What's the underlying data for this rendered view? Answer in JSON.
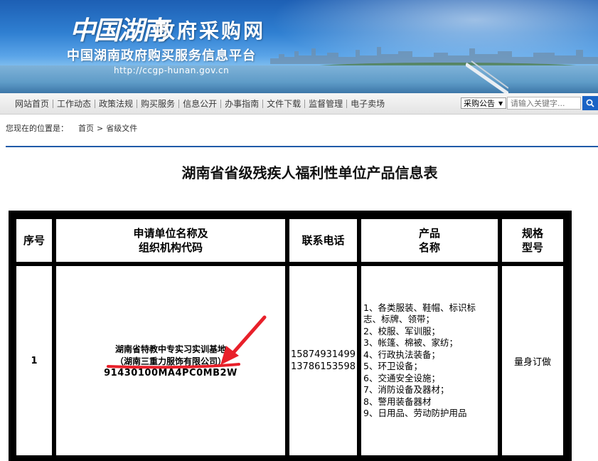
{
  "header": {
    "logo_script": "中国湖南",
    "site_title": "政府采购网",
    "subtitle": "中国湖南政府购买服务信息平台",
    "url": "http://ccgp-hunan.gov.cn"
  },
  "nav": {
    "items": [
      "网站首页",
      "工作动态",
      "政策法规",
      "购买服务",
      "信息公开",
      "办事指南",
      "文件下载",
      "监督管理",
      "电子卖场"
    ]
  },
  "search": {
    "select_value": "采购公告",
    "placeholder": "请输入关键字..."
  },
  "breadcrumb": {
    "prefix": "您现在的位置是：",
    "home": "首页",
    "separator": ">",
    "current": "省级文件"
  },
  "page": {
    "title": "湖南省省级残疾人福利性单位产品信息表"
  },
  "table": {
    "headers": {
      "seq": "序号",
      "org_line1": "申请单位名称及",
      "org_line2": "组织机构代码",
      "phone": "联系电话",
      "product_line1": "产品",
      "product_line2": "名称",
      "spec_line1": "规格",
      "spec_line2": "型号"
    },
    "rows": [
      {
        "seq": "1",
        "org_line1": "湖南省特教中专实习实训基地",
        "org_line2": "（湖南三重力服饰有限公司）",
        "org_code": "91430100MA4PC0MB2W",
        "phone1": "15874931499",
        "phone2": "13786153598",
        "products": [
          "1、各类服装、鞋帽、标识标",
          "志、标牌、领带；",
          "2、校服、军训服；",
          "3、帐篷、棉被、家纺；",
          "4、行政执法装备；",
          "5、环卫设备；",
          "6、交通安全设施；",
          "7、消防设备及器材；",
          "8、警用装备器材",
          "9、日用品、劳动防护用品"
        ],
        "spec": "量身订做"
      }
    ]
  },
  "colors": {
    "accent": "#1f5aa8",
    "annotation": "#e8202a",
    "search_button": "#1a63c5"
  }
}
